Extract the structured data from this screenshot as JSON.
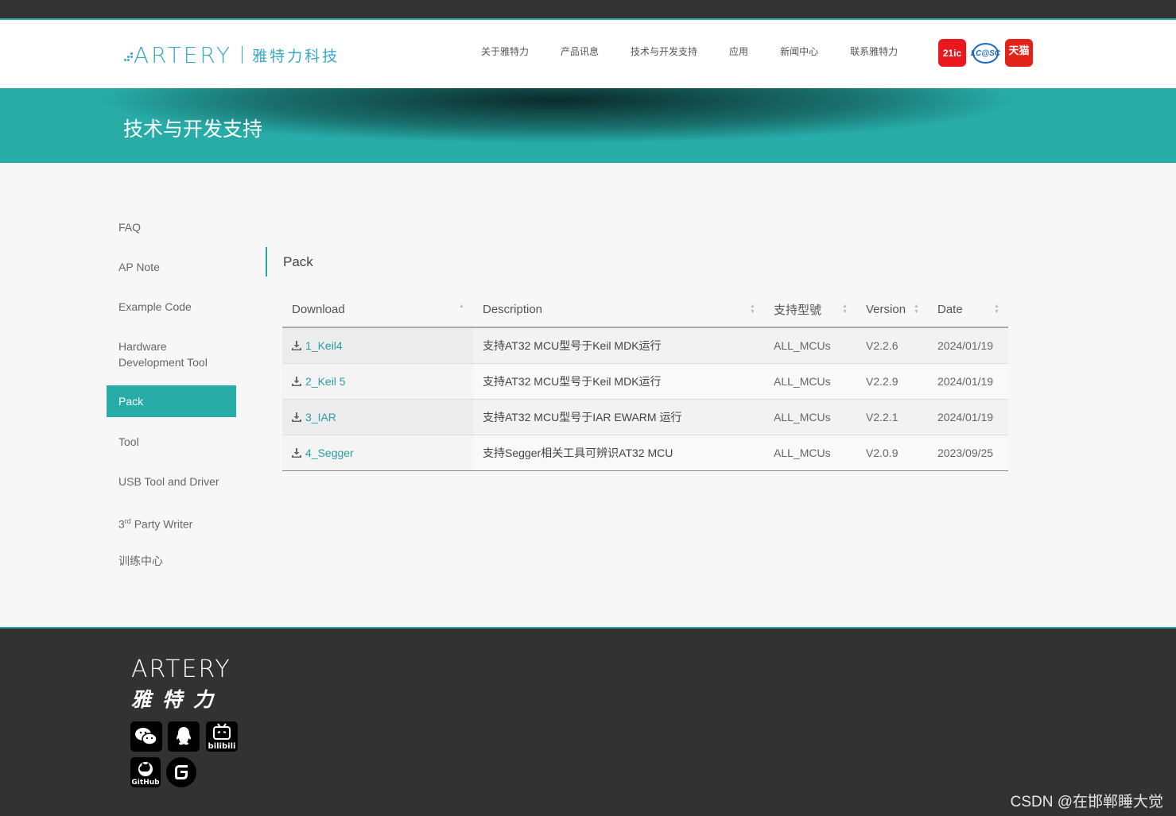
{
  "header": {
    "logo_text": "ARTERY",
    "logo_cn": "雅特力科技",
    "nav": [
      "关于雅特力",
      "产品讯息",
      "技术与开发支持",
      "应用",
      "新闻中心",
      "联系雅特力"
    ],
    "badges": [
      "21ic",
      "LC@SC",
      "天猫"
    ]
  },
  "banner": {
    "title": "技术与开发支持"
  },
  "sidebar": {
    "items": [
      {
        "label": "FAQ"
      },
      {
        "label": "AP Note"
      },
      {
        "label": "Example Code"
      },
      {
        "label": "Hardware Development Tool"
      },
      {
        "label": "Pack"
      },
      {
        "label": "Tool"
      },
      {
        "label": "USB Tool and Driver"
      },
      {
        "label_pre": "3",
        "label_sup": "rd",
        "label_post": " Party Writer"
      },
      {
        "label": "训练中心"
      }
    ]
  },
  "main": {
    "title": "Pack",
    "columns": [
      "Download",
      "Description",
      "支持型號",
      "Version",
      "Date"
    ],
    "rows": [
      {
        "download": "1_Keil4",
        "description": "支持AT32 MCU型号于Keil MDK运行",
        "models": "ALL_MCUs",
        "version": "V2.2.6",
        "date": "2024/01/19"
      },
      {
        "download": "2_Keil 5",
        "description": "支持AT32 MCU型号于Keil MDK运行",
        "models": "ALL_MCUs",
        "version": "V2.2.9",
        "date": "2024/01/19"
      },
      {
        "download": "3_IAR",
        "description": "支持AT32 MCU型号于IAR EWARM 运行",
        "models": "ALL_MCUs",
        "version": "V2.2.1",
        "date": "2024/01/19"
      },
      {
        "download": "4_Segger",
        "description": "支持Segger相关工具可辨识AT32 MCU",
        "models": "ALL_MCUs",
        "version": "V2.0.9",
        "date": "2023/09/25"
      }
    ]
  },
  "footer": {
    "logo_text": "ARTERY",
    "logo_cn": "雅特力",
    "social_icons": [
      "wechat-icon",
      "qq-icon",
      "bilibili-icon",
      "github-icon",
      "gitee-icon"
    ],
    "watermark": "CSDN @在邯郸睡大觉"
  },
  "colors": {
    "accent": "#27aca8",
    "dark": "#323232",
    "link": "#2a9ea0"
  }
}
